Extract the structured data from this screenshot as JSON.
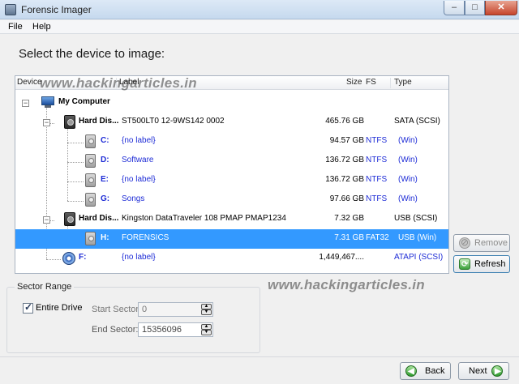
{
  "window": {
    "title": "Forensic Imager"
  },
  "menu": {
    "file": "File",
    "help": "Help"
  },
  "heading": "Select the device to image:",
  "columns": {
    "device": "Device",
    "label": "Label",
    "size": "Size",
    "fs": "FS",
    "type": "Type"
  },
  "watermark": "www.hackingarticles.in",
  "tree": {
    "root": "My Computer",
    "rows": [
      {
        "device": "Hard Dis...",
        "label": "ST500LT0 12-9WS142 0002",
        "size": "465.76 GB",
        "fs": "",
        "type": "SATA (SCSI)"
      },
      {
        "device": "C:",
        "label": "{no label}",
        "size": "94.57 GB",
        "fs": "NTFS",
        "type": "(Win)"
      },
      {
        "device": "D:",
        "label": "Software",
        "size": "136.72 GB",
        "fs": "NTFS",
        "type": "(Win)"
      },
      {
        "device": "E:",
        "label": "{no label}",
        "size": "136.72 GB",
        "fs": "NTFS",
        "type": "(Win)"
      },
      {
        "device": "G:",
        "label": "Songs",
        "size": "97.66 GB",
        "fs": "NTFS",
        "type": "(Win)"
      },
      {
        "device": "Hard Dis...",
        "label": "Kingston DataTraveler 108 PMAP PMAP1234",
        "size": "7.32 GB",
        "fs": "",
        "type": "USB (SCSI)"
      },
      {
        "device": "H:",
        "label": "FORENSICS",
        "size": "7.31 GB",
        "fs": "FAT32",
        "type": "USB (Win)"
      },
      {
        "device": "F:",
        "label": "{no label}",
        "size": "1,449,467....",
        "fs": "",
        "type": "ATAPI (SCSI)"
      }
    ]
  },
  "buttons": {
    "remove": "Remove",
    "refresh": "Refresh",
    "back": "Back",
    "next": "Next"
  },
  "sector": {
    "title": "Sector Range",
    "entire_drive": "Entire Drive",
    "start_label": "Start Sector:",
    "start_value": "0",
    "end_label": "End Sector:",
    "end_value": "15356096"
  },
  "colors": {
    "selection": "#3399ff",
    "link": "#1d2bd6"
  }
}
